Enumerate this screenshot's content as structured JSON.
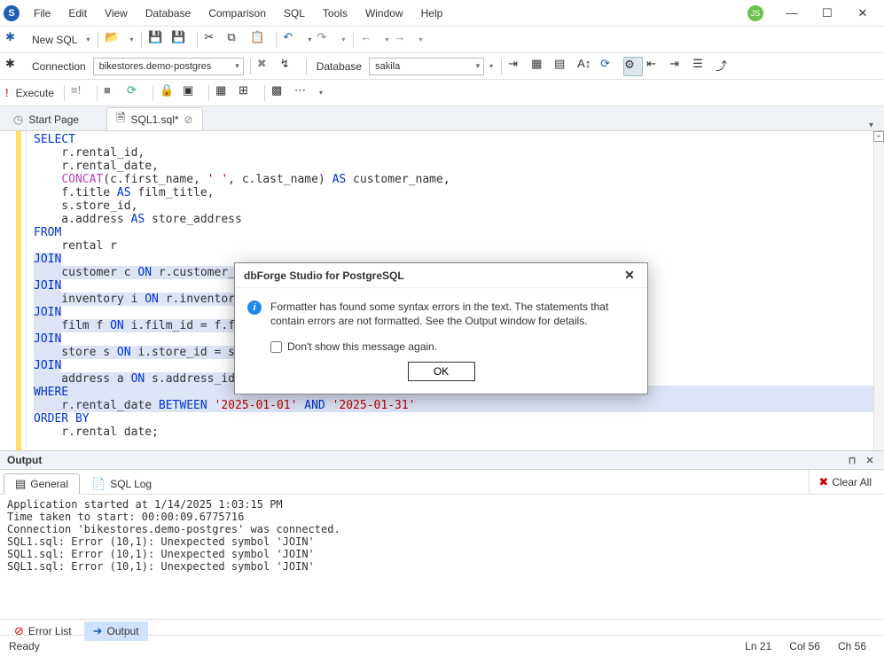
{
  "menu": {
    "items": [
      "File",
      "Edit",
      "View",
      "Database",
      "Comparison",
      "SQL",
      "Tools",
      "Window",
      "Help"
    ]
  },
  "user_badge": "JS",
  "toolbar1": {
    "new_sql": "New SQL"
  },
  "connbar": {
    "conn_label": "Connection",
    "conn_value": "bikestores.demo-postgres",
    "db_label": "Database",
    "db_value": "sakila"
  },
  "execbar": {
    "execute": "Execute"
  },
  "tabs": {
    "start": "Start Page",
    "sql1": "SQL1.sql*"
  },
  "code_lines": [
    {
      "t": "SELECT",
      "cls": "kw"
    },
    {
      "t": "    r.rental_id,"
    },
    {
      "t": "    r.rental_date,"
    },
    {
      "t": "    CONCAT(c.first_name, ' ', c.last_name) AS customer_name,",
      "fn": "CONCAT",
      "str1": "' '",
      "kw2": "AS"
    },
    {
      "t": "    f.title AS film_title,",
      "kw2": "AS"
    },
    {
      "t": "    s.store_id,"
    },
    {
      "t": "    a.address AS store_address",
      "kw2": "AS"
    },
    {
      "t": "FROM",
      "cls": "kw"
    },
    {
      "t": "    rental r"
    },
    {
      "t": "JOIN",
      "cls": "kw",
      "hl": true
    },
    {
      "t": "    customer c ON r.customer_id =",
      "kw3": "ON",
      "hl": true
    },
    {
      "t": "JOIN",
      "cls": "kw",
      "hl": true
    },
    {
      "t": "    inventory i ON r.inventory_i",
      "kw3": "ON",
      "hl": true
    },
    {
      "t": "JOIN",
      "cls": "kw",
      "hl": true
    },
    {
      "t": "    film f ON i.film_id = f.film",
      "kw3": "ON",
      "hl": true
    },
    {
      "t": "JOIN",
      "cls": "kw",
      "hl": true
    },
    {
      "t": "    store s ON i.store_id = s.st",
      "kw3": "ON",
      "hl": true
    },
    {
      "t": "JOIN",
      "cls": "kw",
      "hl": true
    },
    {
      "t": "    address a ON s.address_id = ",
      "kw3": "ON",
      "hl": true
    },
    {
      "t": "WHERE",
      "cls": "kw",
      "hl": true,
      "full": true
    },
    {
      "t": "    r.rental_date BETWEEN '2025-01-01' AND '2025-01-31'",
      "kw4": "BETWEEN",
      "kw5": "AND",
      "str2": "'2025-01-01'",
      "str3": "'2025-01-31'",
      "hl": true,
      "full": true
    },
    {
      "t": "ORDER BY",
      "cls": "kw"
    },
    {
      "t": "    r.rental date;"
    }
  ],
  "output": {
    "title": "Output",
    "tab_general": "General",
    "tab_sqllog": "SQL Log",
    "clear_all": "Clear All",
    "lines": [
      "Application started at 1/14/2025 1:03:15 PM",
      "Time taken to start: 00:00:09.6775716",
      "Connection 'bikestores.demo-postgres' was connected.",
      "SQL1.sql: Error (10,1): Unexpected symbol 'JOIN'",
      "SQL1.sql: Error (10,1): Unexpected symbol 'JOIN'",
      "SQL1.sql: Error (10,1): Unexpected symbol 'JOIN'"
    ]
  },
  "bottom_tabs": {
    "error_list": "Error List",
    "output": "Output"
  },
  "status": {
    "ready": "Ready",
    "ln": "Ln 21",
    "col": "Col 56",
    "ch": "Ch 56"
  },
  "dialog": {
    "title": "dbForge Studio for PostgreSQL",
    "message": "Formatter has found some syntax errors in the text. The statements that contain errors are not formatted. See the Output window for details.",
    "dont_show": "Don't show this message again.",
    "ok": "OK"
  }
}
